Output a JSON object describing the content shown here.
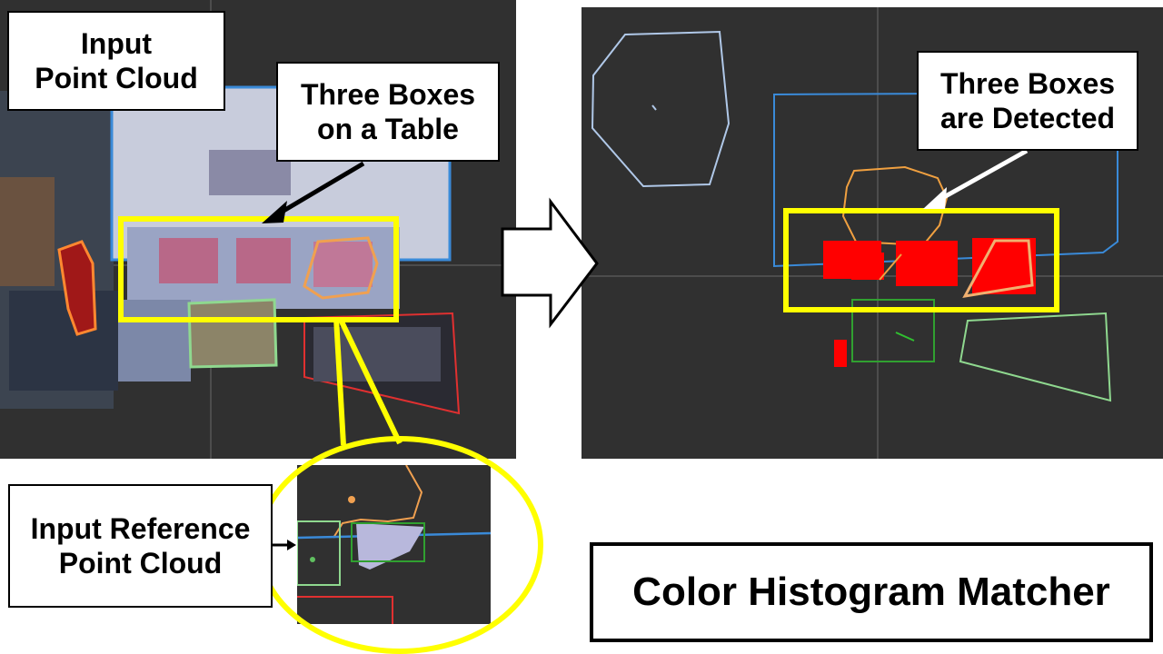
{
  "labels": {
    "input_point_cloud": "Input\nPoint Cloud",
    "three_boxes_on_table": "Three Boxes\non a Table",
    "three_boxes_detected": "Three Boxes\nare Detected",
    "input_reference": "Input Reference\nPoint Cloud",
    "title": "Color Histogram Matcher"
  },
  "colors": {
    "viewport_bg": "#303030",
    "highlight_yellow": "#ffff00",
    "detection_red": "#ff0000",
    "grid_line": "#555555"
  }
}
